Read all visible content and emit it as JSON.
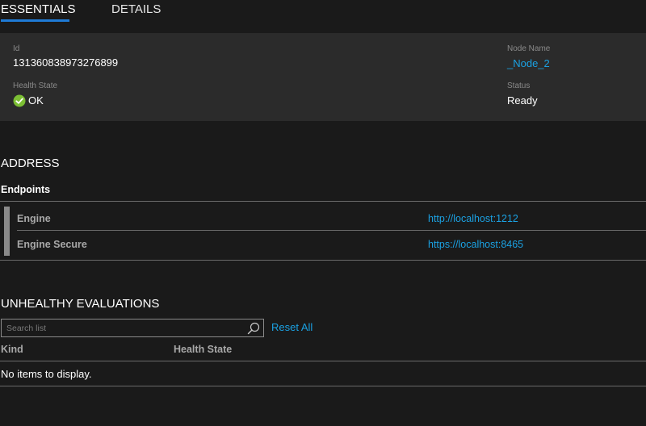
{
  "tabs": [
    {
      "label": "ESSENTIALS",
      "active": true
    },
    {
      "label": "DETAILS",
      "active": false
    }
  ],
  "essentials": {
    "id": {
      "label": "Id",
      "value": "131360838973276899"
    },
    "health_state": {
      "label": "Health State",
      "value": "OK",
      "icon": "check-circle-icon"
    },
    "node_name": {
      "label": "Node Name",
      "value": "_Node_2"
    },
    "status": {
      "label": "Status",
      "value": "Ready"
    }
  },
  "address": {
    "title": "ADDRESS",
    "endpoints_title": "Endpoints",
    "endpoints": [
      {
        "name": "Engine",
        "url": "http://localhost:1212"
      },
      {
        "name": "Engine Secure",
        "url": "https://localhost:8465"
      }
    ]
  },
  "unhealthy": {
    "title": "UNHEALTHY EVALUATIONS",
    "search_placeholder": "Search list",
    "search_value": "",
    "reset_label": "Reset All",
    "columns": [
      "Kind",
      "Health State"
    ],
    "empty_message": "No items to display."
  },
  "colors": {
    "accent": "#1f7bd6",
    "link": "#1ba1e2",
    "ok": "#7cbf34",
    "panel": "#2b2b2b",
    "background": "#1a1a1a"
  }
}
